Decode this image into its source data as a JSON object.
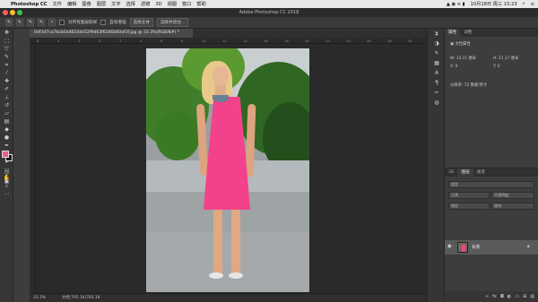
{
  "menubar": {
    "app_name": "Photoshop CC",
    "items": [
      "文件",
      "编辑",
      "图像",
      "图层",
      "文字",
      "选择",
      "滤镜",
      "3D",
      "视图",
      "窗口",
      "帮助"
    ],
    "clock": "10月18日 周三  15:23"
  },
  "window": {
    "title": "Adobe Photoshop CC 2018",
    "light_colors": [
      "#fc5c57",
      "#fdbb2e",
      "#33c748"
    ]
  },
  "options_bar": {
    "sample_all_layers": "对所有图层取样",
    "auto_enhance": "自动增强",
    "select_subject": "选择主体",
    "select_and_mask": "选择并遮住..."
  },
  "document": {
    "tab_title": "0df3d7ca7bcb0a4610de52f9d63f6246b60af3f.jpg @ 33.3%(RGB/8#) *",
    "zoom": "33.3%",
    "status": "文档:795.1K/783.1K"
  },
  "ruler_ticks": [
    "6",
    "4",
    "2",
    "0",
    "2",
    "4",
    "6",
    "8",
    "10",
    "12",
    "14",
    "16",
    "18",
    "20",
    "22",
    "24",
    "26",
    "28",
    "30"
  ],
  "tools": [
    "move-icon",
    "marquee-icon",
    "lasso-icon",
    "quick-select-icon",
    "crop-icon",
    "eyedropper-icon",
    "healing-icon",
    "brush-icon",
    "stamp-icon",
    "history-brush-icon",
    "eraser-icon",
    "gradient-icon",
    "blur-icon",
    "dodge-icon",
    "pen-icon",
    "type-icon",
    "path-select-icon",
    "rectangle-icon",
    "hand-icon",
    "zoom-icon",
    "more-icon"
  ],
  "colors": {
    "foreground": "#f05a8c",
    "background": "#1b1b1b",
    "panel": "#3d3d3d",
    "accent_pink": "#f2428b"
  },
  "properties_panel": {
    "tabs": [
      "属性",
      "调整"
    ],
    "doc_label": "文档属性",
    "width": "W: 14.11 厘米",
    "height": "H: 21.17 厘米",
    "x": "X: 0",
    "y": "Y: 0",
    "resolution": "分辨率: 72 像素/英寸"
  },
  "layers_panel": {
    "tabs": [
      "3D",
      "图层",
      "通道"
    ],
    "filter_label": "类型",
    "mode": "正常",
    "opacity_label": "不透明度:",
    "lock_label": "锁定:",
    "fill_label": "填充:",
    "layer_name": "背景"
  }
}
